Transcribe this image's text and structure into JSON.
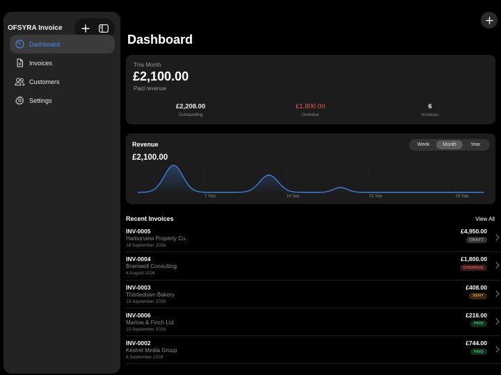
{
  "app": {
    "title": "OFSYRA Invoice"
  },
  "sidebar": {
    "items": [
      {
        "label": "Dashboard",
        "icon": "dashboard-gauge-icon",
        "active": true
      },
      {
        "label": "Invoices",
        "icon": "document-icon",
        "active": false
      },
      {
        "label": "Customers",
        "icon": "people-icon",
        "active": false
      },
      {
        "label": "Settings",
        "icon": "gear-icon",
        "active": false
      }
    ]
  },
  "page": {
    "title": "Dashboard"
  },
  "summary": {
    "period_label": "This Month",
    "amount": "£2,100.00",
    "subtitle": "Paid revenue",
    "stats": [
      {
        "value": "£2,208.00",
        "label": "Outstanding"
      },
      {
        "value": "£1,800.00",
        "label": "Overdue"
      },
      {
        "value": "6",
        "label": "Invoices"
      }
    ]
  },
  "revenue": {
    "title": "Revenue",
    "amount": "£2,100.00",
    "periods": [
      "Week",
      "Month",
      "Year"
    ],
    "selected_period": "Month"
  },
  "chart_data": {
    "type": "area",
    "x_ticks": [
      "7 Sep",
      "14 Sep",
      "21 Sep",
      "28 Sep"
    ],
    "peaks": [
      {
        "day": 4,
        "value": 1.0
      },
      {
        "day": 12,
        "value": 0.64
      },
      {
        "day": 18,
        "value": 0.18
      }
    ],
    "x_range": [
      1,
      30
    ],
    "line_color": "#3f7fdc"
  },
  "recent": {
    "title": "Recent Invoices",
    "view_all": "View All",
    "invoices": [
      {
        "id": "INV-0005",
        "client": "Harborview Property Co.",
        "date": "18 September 2026",
        "amount": "£4,950.00",
        "status": "DRAFT",
        "status_color": "#9a9a9a",
        "status_bg": "#333333"
      },
      {
        "id": "INV-0004",
        "client": "Bramwell Consulting",
        "date": "4 August 2026",
        "amount": "£1,800.00",
        "status": "OVERDUE",
        "status_color": "#e25b5b",
        "status_bg": "#3a1b1b"
      },
      {
        "id": "INV-0003",
        "client": "Thistledown Bakery",
        "date": "13 September 2026",
        "amount": "£408.00",
        "status": "SENT",
        "status_color": "#e0953a",
        "status_bg": "#3a2712"
      },
      {
        "id": "INV-0006",
        "client": "Marlow & Finch Ltd",
        "date": "15 September 2026",
        "amount": "£216.00",
        "status": "PAID",
        "status_color": "#43c26b",
        "status_bg": "#13301e"
      },
      {
        "id": "INV-0002",
        "client": "Kestrel Media Group",
        "date": "6 September 2026",
        "amount": "£744.00",
        "status": "PAID",
        "status_color": "#43c26b",
        "status_bg": "#13301e"
      }
    ]
  }
}
